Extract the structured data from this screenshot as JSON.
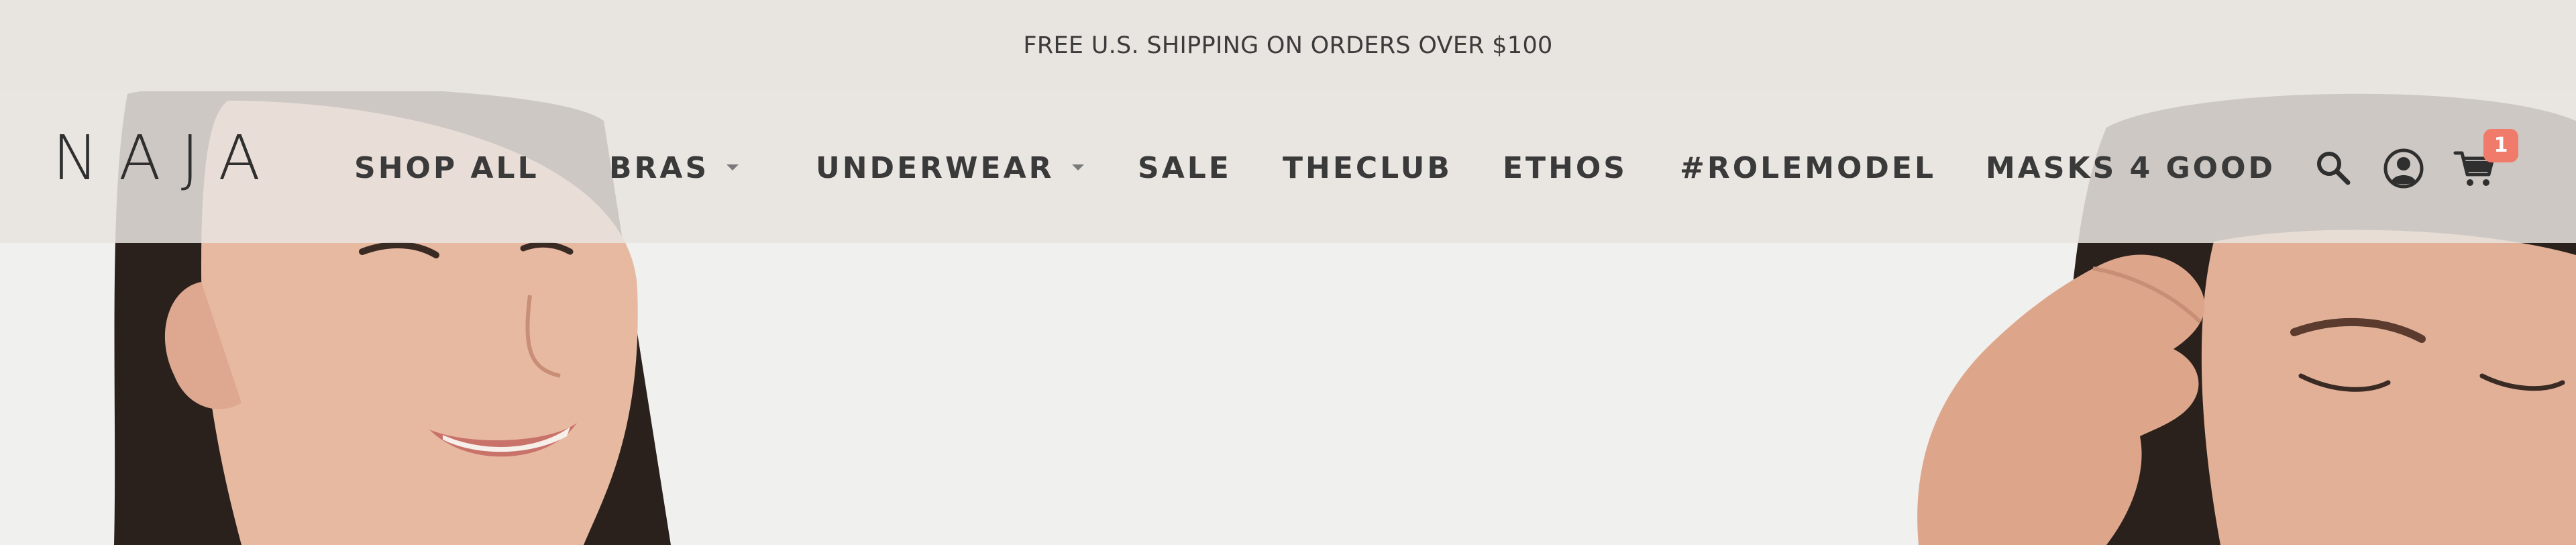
{
  "announcement": {
    "text": "FREE U.S. SHIPPING ON ORDERS OVER $100"
  },
  "header": {
    "logo": "NAJA",
    "nav": [
      {
        "label": "SHOP ALL",
        "has_dropdown": false
      },
      {
        "label": "BRAS",
        "has_dropdown": true
      },
      {
        "label": "UNDERWEAR",
        "has_dropdown": true
      },
      {
        "label": "SALE",
        "has_dropdown": false
      },
      {
        "label": "THECLUB",
        "has_dropdown": false
      },
      {
        "label": "ETHOS",
        "has_dropdown": false
      },
      {
        "label": "#ROLEMODEL",
        "has_dropdown": false
      },
      {
        "label": "MASKS 4 GOOD",
        "has_dropdown": false
      }
    ],
    "icons": [
      "search-icon",
      "account-icon",
      "cart-icon"
    ],
    "cart_count": "1"
  },
  "colors": {
    "announcement_bg": "#e8e4df",
    "text": "#3a3a3a",
    "badge": "#f07b6a"
  }
}
